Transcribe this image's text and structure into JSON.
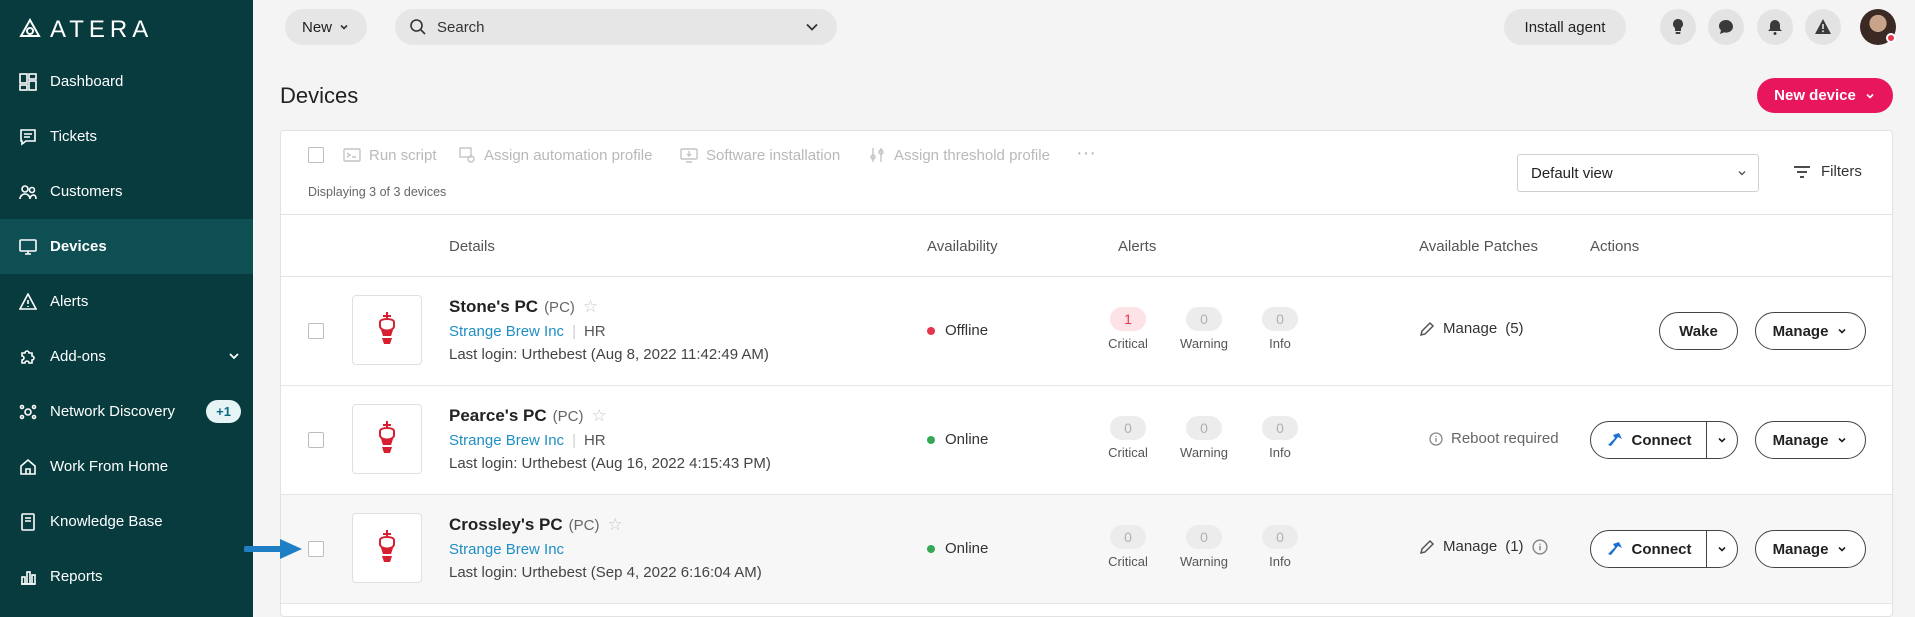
{
  "sidebar": {
    "logo": "ATERA",
    "items": [
      {
        "label": "Dashboard",
        "icon": "dashboard-icon"
      },
      {
        "label": "Tickets",
        "icon": "tickets-icon"
      },
      {
        "label": "Customers",
        "icon": "customers-icon"
      },
      {
        "label": "Devices",
        "icon": "monitor-icon",
        "active": true
      },
      {
        "label": "Alerts",
        "icon": "alert-triangle-icon"
      },
      {
        "label": "Add-ons",
        "icon": "puzzle-icon"
      },
      {
        "label": "Network Discovery",
        "icon": "network-icon",
        "badge": "+1"
      },
      {
        "label": "Work From Home",
        "icon": "home-icon"
      },
      {
        "label": "Knowledge Base",
        "icon": "book-icon"
      },
      {
        "label": "Reports",
        "icon": "bar-chart-icon"
      }
    ]
  },
  "topbar": {
    "new_label": "New",
    "search_placeholder": "Search",
    "install_label": "Install agent"
  },
  "page": {
    "title": "Devices",
    "new_device_label": "New device"
  },
  "toolbar": {
    "run_script": "Run script",
    "assign_automation": "Assign automation profile",
    "software_installation": "Software installation",
    "assign_threshold": "Assign threshold profile",
    "more": "···",
    "count_text": "Displaying 3 of 3 devices",
    "view_value": "Default view",
    "filters_label": "Filters"
  },
  "columns": {
    "details": "Details",
    "availability": "Availability",
    "alerts": "Alerts",
    "patches": "Available Patches",
    "actions": "Actions"
  },
  "alert_labels": {
    "critical": "Critical",
    "warning": "Warning",
    "info": "Info"
  },
  "devices": [
    {
      "name": "Stone's PC",
      "type": "(PC)",
      "company": "Strange Brew Inc",
      "dept": "HR",
      "last_login": "Last login: Urthebest (Aug 8, 2022 11:42:49 AM)",
      "status": "Offline",
      "status_color": "#e5364b",
      "critical": "1",
      "warning": "0",
      "info": "0",
      "patch_text": "Manage",
      "patch_count": "(5)",
      "action_primary": "Wake",
      "manage_label": "Manage"
    },
    {
      "name": "Pearce's PC",
      "type": "(PC)",
      "company": "Strange Brew Inc",
      "dept": "HR",
      "last_login": "Last login: Urthebest (Aug 16, 2022 4:15:43 PM)",
      "status": "Online",
      "status_color": "#35a853",
      "critical": "0",
      "warning": "0",
      "info": "0",
      "patch_text": "Reboot required",
      "action_primary": "Connect",
      "manage_label": "Manage"
    },
    {
      "name": "Crossley's PC",
      "type": "(PC)",
      "company": "Strange Brew Inc",
      "last_login": "Last login: Urthebest (Sep 4, 2022 6:16:04 AM)",
      "status": "Online",
      "status_color": "#35a853",
      "critical": "0",
      "warning": "0",
      "info": "0",
      "patch_text": "Manage",
      "patch_count": "(1)",
      "action_primary": "Connect",
      "manage_label": "Manage"
    }
  ],
  "colors": {
    "sidebar_bg": "#083b3e",
    "accent_pink": "#e8175d",
    "link_blue": "#1f8fc4"
  }
}
